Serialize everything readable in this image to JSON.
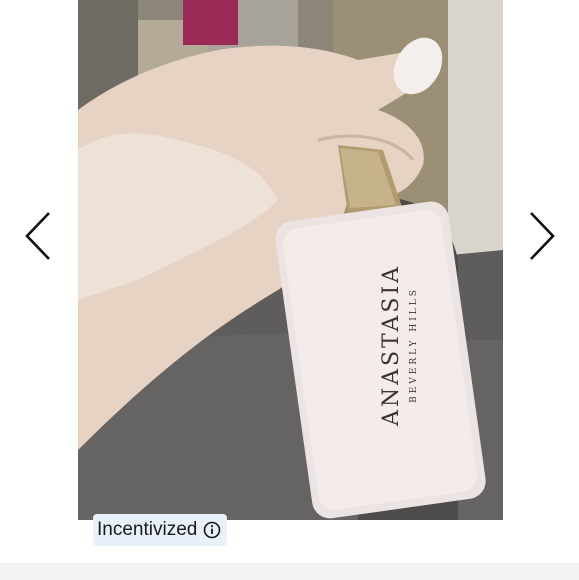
{
  "gallery": {
    "prev_icon": "chevron-left-icon",
    "next_icon": "chevron-right-icon"
  },
  "photo": {
    "brand_name": "ANASTASIA",
    "brand_sub": "BEVERLY HILLS"
  },
  "badge": {
    "label": "Incentivized",
    "icon": "info-icon"
  },
  "colors": {
    "badge_bg": "#e8f0fb",
    "arrow": "#111111",
    "page_bg": "#ffffff"
  }
}
